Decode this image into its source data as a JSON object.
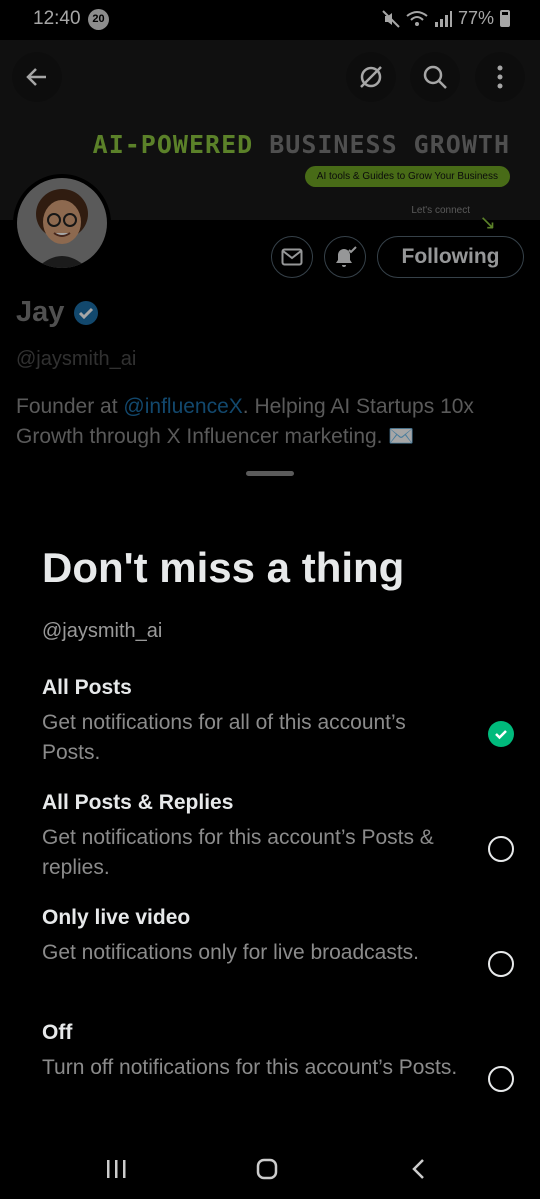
{
  "status_bar": {
    "time": "12:40",
    "notification_count": "20",
    "battery": "77%"
  },
  "banner": {
    "title_accent": "AI-POWERED",
    "title_rest": " BUSINESS GROWTH",
    "tagline": "AI tools & Guides to Grow Your Business",
    "connect": "Let's connect"
  },
  "profile": {
    "name": "Jay",
    "handle": "@jaysmith_ai",
    "bio_prefix": "Founder at ",
    "bio_mention": "@influenceX",
    "bio_suffix": ". Helping AI Startups 10x Growth through X Influencer marketing. ✉️",
    "following_label": "Following"
  },
  "sheet": {
    "title": "Don't miss a thing",
    "handle": "@jaysmith_ai",
    "options": [
      {
        "title": "All Posts",
        "desc": "Get notifications for all of this account’s Posts.",
        "selected": true
      },
      {
        "title": "All Posts & Replies",
        "desc": "Get notifications for this account’s Posts & replies.",
        "selected": false
      },
      {
        "title": "Only live video",
        "desc": "Get notifications only for live broadcasts.",
        "selected": false
      },
      {
        "title": "Off",
        "desc": "Turn off notifications for this account’s Posts.",
        "selected": false
      }
    ]
  },
  "colors": {
    "accent_green": "#00ba7c",
    "link_blue": "#1d9bf0",
    "banner_green": "#8cc63f"
  }
}
